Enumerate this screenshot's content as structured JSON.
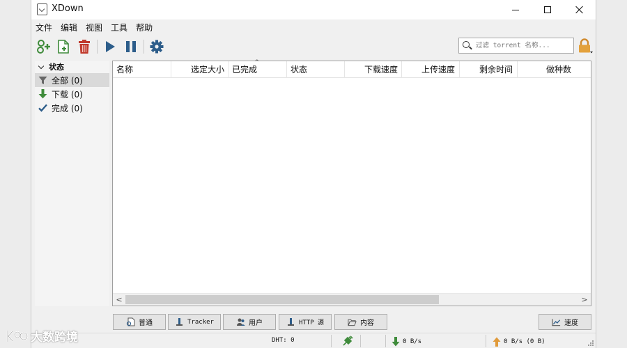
{
  "window": {
    "title": "XDown"
  },
  "menu": [
    "文件",
    "编辑",
    "视图",
    "工具",
    "帮助"
  ],
  "toolbar": {
    "buttons": [
      "add-torrent-icon",
      "new-file-icon",
      "delete-icon",
      "play-icon",
      "pause-icon",
      "gear-icon"
    ],
    "colors": {
      "green": "#3f8b3b",
      "red": "#c0392b",
      "blue": "#2d5d8a"
    }
  },
  "search": {
    "placeholder": "过滤 torrent 名称..."
  },
  "sidebar": {
    "heading": "状态",
    "items": [
      {
        "label": "全部 (0)",
        "icon": "filter-icon",
        "selected": true
      },
      {
        "label": "下载 (0)",
        "icon": "download-arrow-icon",
        "selected": false
      },
      {
        "label": "完成 (0)",
        "icon": "check-icon",
        "selected": false
      }
    ]
  },
  "table": {
    "columns": [
      "名称",
      "选定大小",
      "已完成",
      "状态",
      "下载速度",
      "上传速度",
      "剩余时间",
      "做种数"
    ],
    "rows": []
  },
  "tabs": [
    "普通",
    "Tracker",
    "用户",
    "HTTP 源",
    "内容"
  ],
  "speed_button": "速度",
  "status": {
    "dht": "DHT: 0",
    "download": "0 B/s",
    "upload": "0 B/s (0 B)"
  },
  "watermark": "大数跨境"
}
